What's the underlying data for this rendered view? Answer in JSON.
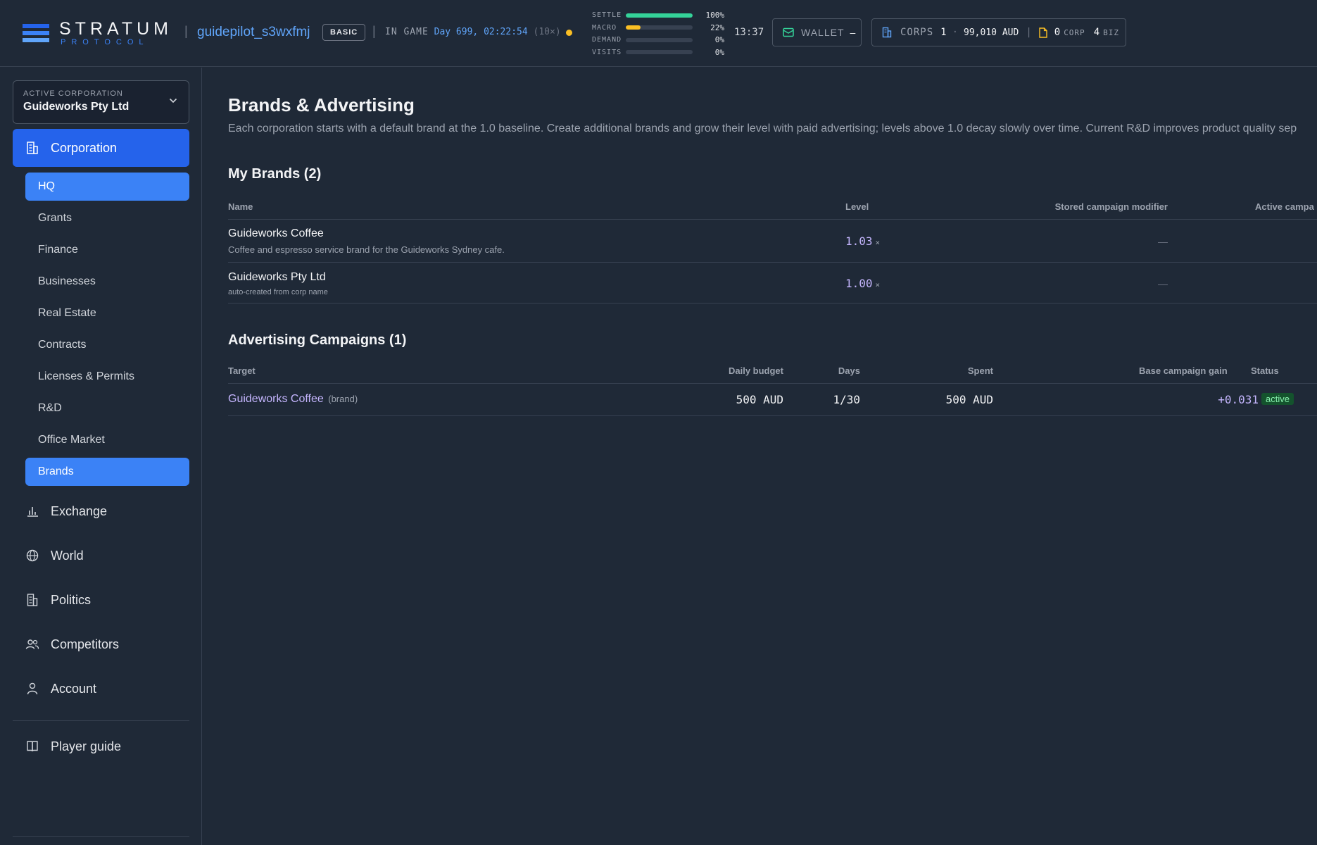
{
  "header": {
    "logo_word": "STRATUM",
    "logo_sub": "PROTOCOL",
    "username": "guidepilot_s3wxfmj",
    "tier": "BASIC",
    "ingame_label": "IN GAME",
    "ingame_value": "Day 699, 02:22:54",
    "speed": "(10×)",
    "meters": [
      {
        "label": "SETTLE",
        "value": "100%",
        "fill": 1.0,
        "color": "#34d399"
      },
      {
        "label": "MACRO",
        "value": "22%",
        "fill": 0.22,
        "color": "#fbbf24"
      },
      {
        "label": "DEMAND",
        "value": "0%",
        "fill": 0.0,
        "color": "#60a5fa"
      },
      {
        "label": "VISITS",
        "value": "0%",
        "fill": 0.0,
        "color": "#60a5fa"
      }
    ],
    "clock": "13:37",
    "wallet_label": "WALLET",
    "wallet_value": "–",
    "corps_label": "CORPS",
    "corps_count": "1",
    "corps_dot": "·",
    "corps_amount": "99,010 AUD",
    "corp_docs_count": "0",
    "corp_docs_label": "CORP",
    "biz_count": "4",
    "biz_label": "BIZ"
  },
  "sidebar": {
    "active_corp_label": "ACTIVE CORPORATION",
    "active_corp_name": "Guideworks Pty Ltd",
    "corporation_label": "Corporation",
    "sub_items": [
      {
        "label": "HQ"
      },
      {
        "label": "Grants"
      },
      {
        "label": "Finance"
      },
      {
        "label": "Businesses"
      },
      {
        "label": "Real Estate"
      },
      {
        "label": "Contracts"
      },
      {
        "label": "Licenses & Permits"
      },
      {
        "label": "R&D"
      },
      {
        "label": "Office Market"
      },
      {
        "label": "Brands"
      }
    ],
    "main_items": [
      {
        "label": "Exchange",
        "icon": "bar-chart-icon"
      },
      {
        "label": "World",
        "icon": "globe-icon"
      },
      {
        "label": "Politics",
        "icon": "building-icon"
      },
      {
        "label": "Competitors",
        "icon": "users-icon"
      },
      {
        "label": "Account",
        "icon": "user-icon"
      }
    ],
    "guide_label": "Player guide"
  },
  "main": {
    "title": "Brands & Advertising",
    "description": "Each corporation starts with a default brand at the 1.0 baseline. Create additional brands and grow their level with paid advertising; levels above 1.0 decay slowly over time. Current R&D improves product quality sep",
    "brands_title": "My Brands (2)",
    "brands_headers": {
      "name": "Name",
      "level": "Level",
      "stored": "Stored campaign modifier",
      "active": "Active campa"
    },
    "brands": [
      {
        "name": "Guideworks Coffee",
        "description": "Coffee and espresso service brand for the Guideworks Sydney cafe.",
        "level": "1.03",
        "level_suffix": "×",
        "stored": "—"
      },
      {
        "name": "Guideworks Pty Ltd",
        "description": "auto-created from corp name",
        "level": "1.00",
        "level_suffix": "×",
        "stored": "—"
      }
    ],
    "campaigns_title": "Advertising Campaigns (1)",
    "campaign_headers": {
      "target": "Target",
      "budget": "Daily budget",
      "days": "Days",
      "spent": "Spent",
      "gain": "Base campaign gain",
      "status": "Status"
    },
    "campaigns": [
      {
        "target": "Guideworks Coffee",
        "kind": "(brand)",
        "budget": "500 AUD",
        "days": "1/30",
        "spent": "500 AUD",
        "gain": "+0.031",
        "status": "active"
      }
    ]
  }
}
